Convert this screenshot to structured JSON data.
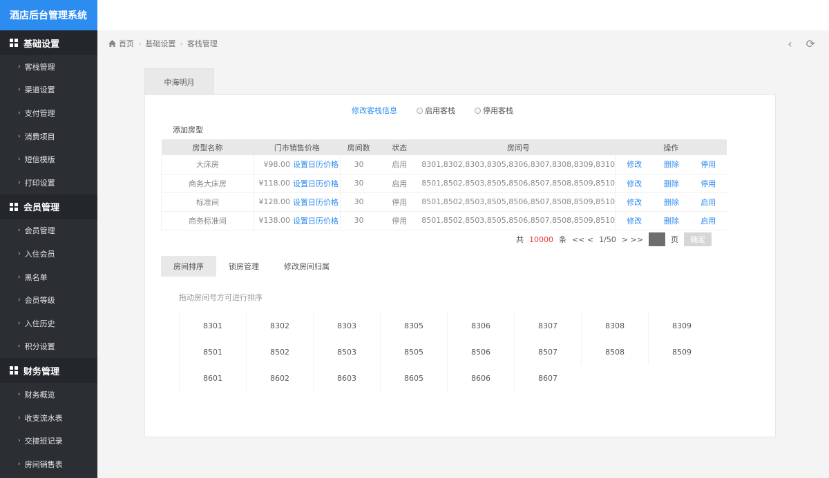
{
  "sidebar": {
    "brand": "酒店后台管理系统",
    "groups": [
      {
        "title": "基础设置",
        "items": [
          "客栈管理",
          "渠道设置",
          "支付管理",
          "消费项目",
          "短信模版",
          "打印设置"
        ]
      },
      {
        "title": "会员管理",
        "items": [
          "会员管理",
          "入住会员",
          "黑名单",
          "会员等级",
          "入住历史",
          "积分设置"
        ]
      },
      {
        "title": "财务管理",
        "items": [
          "财务概览",
          "收支流水表",
          "交接班记录",
          "房间销售表"
        ]
      }
    ]
  },
  "breadcrumb": [
    "首页",
    "基础设置",
    "客栈管理"
  ],
  "hotel_tab": "中海明月",
  "actions": {
    "edit_info": "修改客栈信息",
    "enable": "启用客栈",
    "disable": "停用客栈"
  },
  "add_room_type": "添加房型",
  "table": {
    "headers": [
      "房型名称",
      "门市销售价格",
      "房间数",
      "状态",
      "房间号",
      "操作"
    ],
    "rows": [
      {
        "name": "大床房",
        "price": "¥98.00",
        "set_price": "设置日历价格",
        "count": "30",
        "status": "启用",
        "rooms": "8301,8302,8303,8305,8306,8307,8308,8309,8310",
        "op1": "修改",
        "op2": "删除",
        "op3": "停用"
      },
      {
        "name": "商务大床房",
        "price": "¥118.00",
        "set_price": "设置日历价格",
        "count": "30",
        "status": "启用",
        "rooms": "8501,8502,8503,8505,8506,8507,8508,8509,8510",
        "op1": "修改",
        "op2": "删除",
        "op3": "停用"
      },
      {
        "name": "标准间",
        "price": "¥128.00",
        "set_price": "设置日历价格",
        "count": "30",
        "status": "停用",
        "rooms": "8501,8502,8503,8505,8506,8507,8508,8509,8510",
        "op1": "修改",
        "op2": "删除",
        "op3": "启用"
      },
      {
        "name": "商务标准间",
        "price": "¥138.00",
        "set_price": "设置日历价格",
        "count": "30",
        "status": "停用",
        "rooms": "8501,8502,8503,8505,8506,8507,8508,8509,8510",
        "op1": "修改",
        "op2": "删除",
        "op3": "启用"
      }
    ]
  },
  "pager": {
    "prefix": "共",
    "total": "10000",
    "unit": "条",
    "prev": "<< <",
    "page": "1/50",
    "next": "> >>",
    "page_unit": "页",
    "confirm": "确定"
  },
  "subtabs": [
    "房间排序",
    "锁房管理",
    "修改房间归属"
  ],
  "hint": "拖动房间号方可进行排序",
  "room_grid": [
    [
      "8301",
      "8302",
      "8303",
      "8305",
      "8306",
      "8307",
      "8308",
      "8309"
    ],
    [
      "8501",
      "8502",
      "8503",
      "8505",
      "8506",
      "8507",
      "8508",
      "8509"
    ],
    [
      "8601",
      "8602",
      "8603",
      "8605",
      "8606",
      "8607"
    ]
  ],
  "colors": {
    "brand": "#2d8cf0",
    "sidebar": "#2b2e33",
    "link": "#2d8cf0",
    "total": "#ee3333"
  }
}
